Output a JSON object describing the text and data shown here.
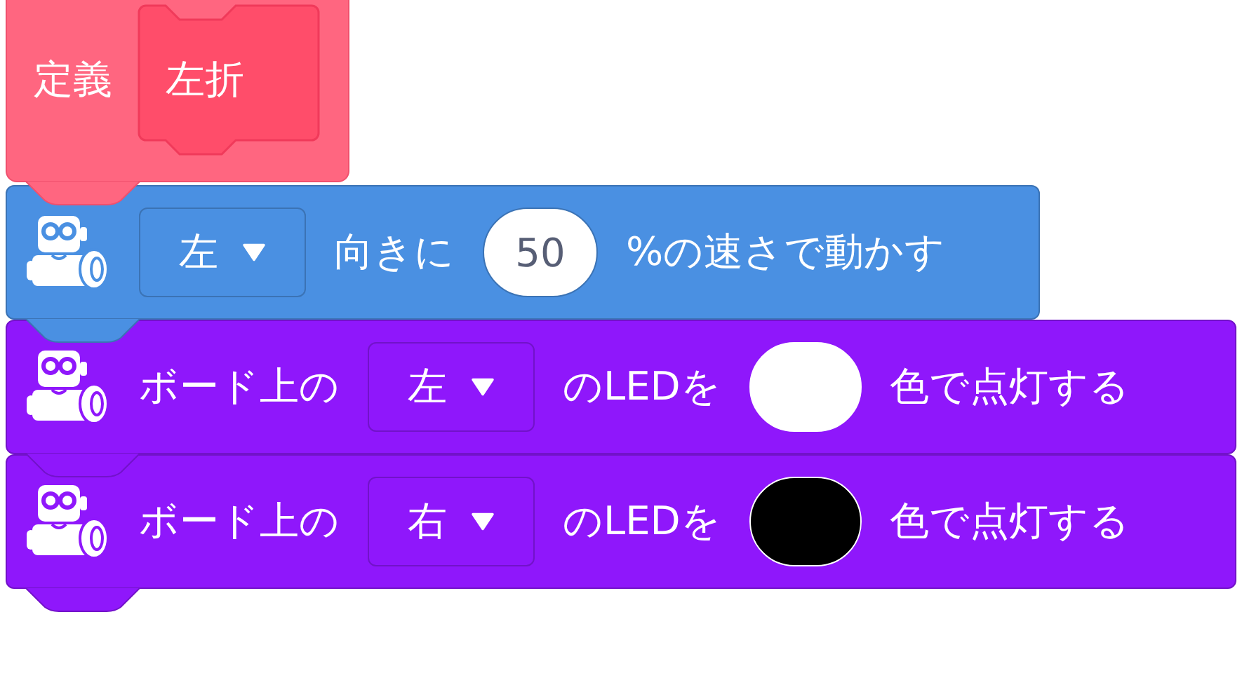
{
  "define_block": {
    "label": "定義",
    "procedure": "左折"
  },
  "blocks": [
    {
      "kind": "motion",
      "color": "#4a90e2",
      "parts": [
        {
          "kind": "dropdown",
          "text": "左"
        },
        {
          "kind": "text",
          "text": "向きに"
        },
        {
          "kind": "number",
          "text": "50"
        },
        {
          "kind": "text",
          "text": "%の速さで動かす"
        }
      ]
    },
    {
      "kind": "led",
      "color": "#8f17fb",
      "parts": [
        {
          "kind": "text",
          "text": "ボード上の"
        },
        {
          "kind": "dropdown",
          "text": "左"
        },
        {
          "kind": "text",
          "text": "のLEDを"
        },
        {
          "kind": "swatch",
          "color": "#ffffff"
        },
        {
          "kind": "text",
          "text": "色で点灯する"
        }
      ]
    },
    {
      "kind": "led",
      "color": "#8f17fb",
      "parts": [
        {
          "kind": "text",
          "text": "ボード上の"
        },
        {
          "kind": "dropdown",
          "text": "右"
        },
        {
          "kind": "text",
          "text": "のLEDを"
        },
        {
          "kind": "swatch",
          "color": "#000000"
        },
        {
          "kind": "text",
          "text": "色で点灯する"
        }
      ]
    }
  ]
}
